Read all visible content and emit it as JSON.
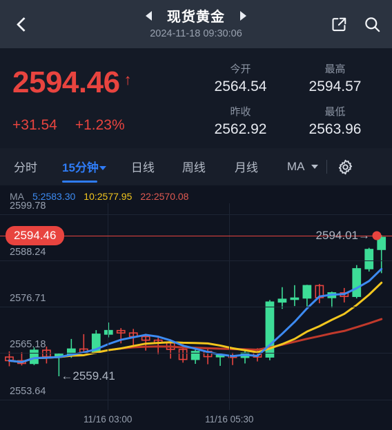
{
  "header": {
    "back_icon": "chevron-left-icon",
    "prev_icon": "triangle-left-icon",
    "next_icon": "triangle-right-icon",
    "title": "现货黄金",
    "timestamp": "2024-11-18 09:30:06",
    "share_icon": "share-external-link-icon",
    "search_icon": "search-icon"
  },
  "quote": {
    "last_price": "2594.46",
    "direction_arrow": "↑",
    "change_abs": "+31.54",
    "change_pct": "+1.23%",
    "up_color": "#e8443f",
    "stats": [
      {
        "label": "今开",
        "value": "2564.54"
      },
      {
        "label": "最高",
        "value": "2594.57"
      },
      {
        "label": "昨收",
        "value": "2562.92"
      },
      {
        "label": "最低",
        "value": "2563.96"
      }
    ]
  },
  "tabs": {
    "items": [
      {
        "label": "分时",
        "active": false
      },
      {
        "label": "15分钟",
        "active": true,
        "has_caret": true
      },
      {
        "label": "日线",
        "active": false
      },
      {
        "label": "周线",
        "active": false
      },
      {
        "label": "月线",
        "active": false
      }
    ],
    "ma_label": "MA",
    "ma_caret_icon": "chevron-down-icon",
    "settings_icon": "gear-icon"
  },
  "chart_data": {
    "type": "candlestick",
    "title": "现货黄金 15分钟",
    "ma_legend": {
      "prefix": "MA",
      "entries": [
        {
          "name": "5",
          "value": "2583.30",
          "color": "#3d8bf2"
        },
        {
          "name": "10",
          "value": "2577.95",
          "color": "#f2c61e"
        },
        {
          "name": "22",
          "value": "2570.08",
          "color": "#e05a52"
        }
      ]
    },
    "y_ticks": [
      2599.78,
      2588.24,
      2576.71,
      2565.18,
      2553.64
    ],
    "ylim": [
      2551.0,
      2602.5
    ],
    "x_ticks": [
      "11/16 03:00",
      "11/16 05:30"
    ],
    "x_tick_positions": [
      0.275,
      0.585
    ],
    "grid": true,
    "price_line": {
      "value": 2594.46,
      "badge_text": "2594.46",
      "color": "#e8443f"
    },
    "last_marker": {
      "label": "2594.01→",
      "value": 2594.01
    },
    "low_marker": {
      "label": "←2559.41",
      "value": 2559.41
    },
    "up_color": "#3ddc97",
    "down_color": "#e8443f",
    "candles": [
      {
        "o": 2564.2,
        "h": 2565.6,
        "l": 2561.9,
        "c": 2563.3
      },
      {
        "o": 2563.3,
        "h": 2565.4,
        "l": 2562.1,
        "c": 2562.6
      },
      {
        "o": 2562.6,
        "h": 2566.6,
        "l": 2562.2,
        "c": 2565.9
      },
      {
        "o": 2565.9,
        "h": 2566.8,
        "l": 2562.6,
        "c": 2564.3
      },
      {
        "o": 2564.3,
        "h": 2565.2,
        "l": 2559.41,
        "c": 2564.9
      },
      {
        "o": 2564.9,
        "h": 2568.7,
        "l": 2564.0,
        "c": 2566.2
      },
      {
        "o": 2566.2,
        "h": 2569.9,
        "l": 2565.1,
        "c": 2565.4
      },
      {
        "o": 2565.4,
        "h": 2570.9,
        "l": 2565.0,
        "c": 2569.9
      },
      {
        "o": 2569.9,
        "h": 2572.8,
        "l": 2569.1,
        "c": 2570.8
      },
      {
        "o": 2570.8,
        "h": 2571.4,
        "l": 2567.6,
        "c": 2570.2
      },
      {
        "o": 2570.2,
        "h": 2571.2,
        "l": 2566.4,
        "c": 2569.3
      },
      {
        "o": 2569.3,
        "h": 2570.0,
        "l": 2565.8,
        "c": 2568.4
      },
      {
        "o": 2568.4,
        "h": 2569.2,
        "l": 2564.9,
        "c": 2567.7
      },
      {
        "o": 2567.7,
        "h": 2568.6,
        "l": 2563.8,
        "c": 2566.1
      },
      {
        "o": 2566.1,
        "h": 2567.4,
        "l": 2562.8,
        "c": 2563.6
      },
      {
        "o": 2563.6,
        "h": 2566.1,
        "l": 2562.5,
        "c": 2565.6
      },
      {
        "o": 2565.6,
        "h": 2566.2,
        "l": 2562.4,
        "c": 2564.3
      },
      {
        "o": 2564.3,
        "h": 2565.1,
        "l": 2562.0,
        "c": 2564.6
      },
      {
        "o": 2564.6,
        "h": 2565.3,
        "l": 2562.2,
        "c": 2564.1
      },
      {
        "o": 2564.1,
        "h": 2565.8,
        "l": 2562.6,
        "c": 2565.2
      },
      {
        "o": 2565.2,
        "h": 2566.4,
        "l": 2563.1,
        "c": 2564.2
      },
      {
        "o": 2564.2,
        "h": 2578.4,
        "l": 2563.4,
        "c": 2577.9
      },
      {
        "o": 2577.9,
        "h": 2581.6,
        "l": 2576.2,
        "c": 2578.6
      },
      {
        "o": 2578.6,
        "h": 2582.1,
        "l": 2576.9,
        "c": 2578.9
      },
      {
        "o": 2578.9,
        "h": 2582.2,
        "l": 2576.8,
        "c": 2582.0
      },
      {
        "o": 2582.0,
        "h": 2582.4,
        "l": 2577.6,
        "c": 2579.0
      },
      {
        "o": 2579.0,
        "h": 2580.5,
        "l": 2576.5,
        "c": 2580.2
      },
      {
        "o": 2580.2,
        "h": 2581.4,
        "l": 2577.8,
        "c": 2579.3
      },
      {
        "o": 2579.3,
        "h": 2587.1,
        "l": 2578.8,
        "c": 2586.2
      },
      {
        "o": 2586.2,
        "h": 2591.4,
        "l": 2585.5,
        "c": 2591.0
      },
      {
        "o": 2591.0,
        "h": 2594.57,
        "l": 2585.1,
        "c": 2594.01
      }
    ],
    "ma_lines": {
      "ma5": {
        "color": "#3d8bf2",
        "width": 3
      },
      "ma10": {
        "color": "#f2c61e",
        "width": 3
      },
      "ma22": {
        "color": "#c0392b",
        "width": 3
      }
    }
  }
}
